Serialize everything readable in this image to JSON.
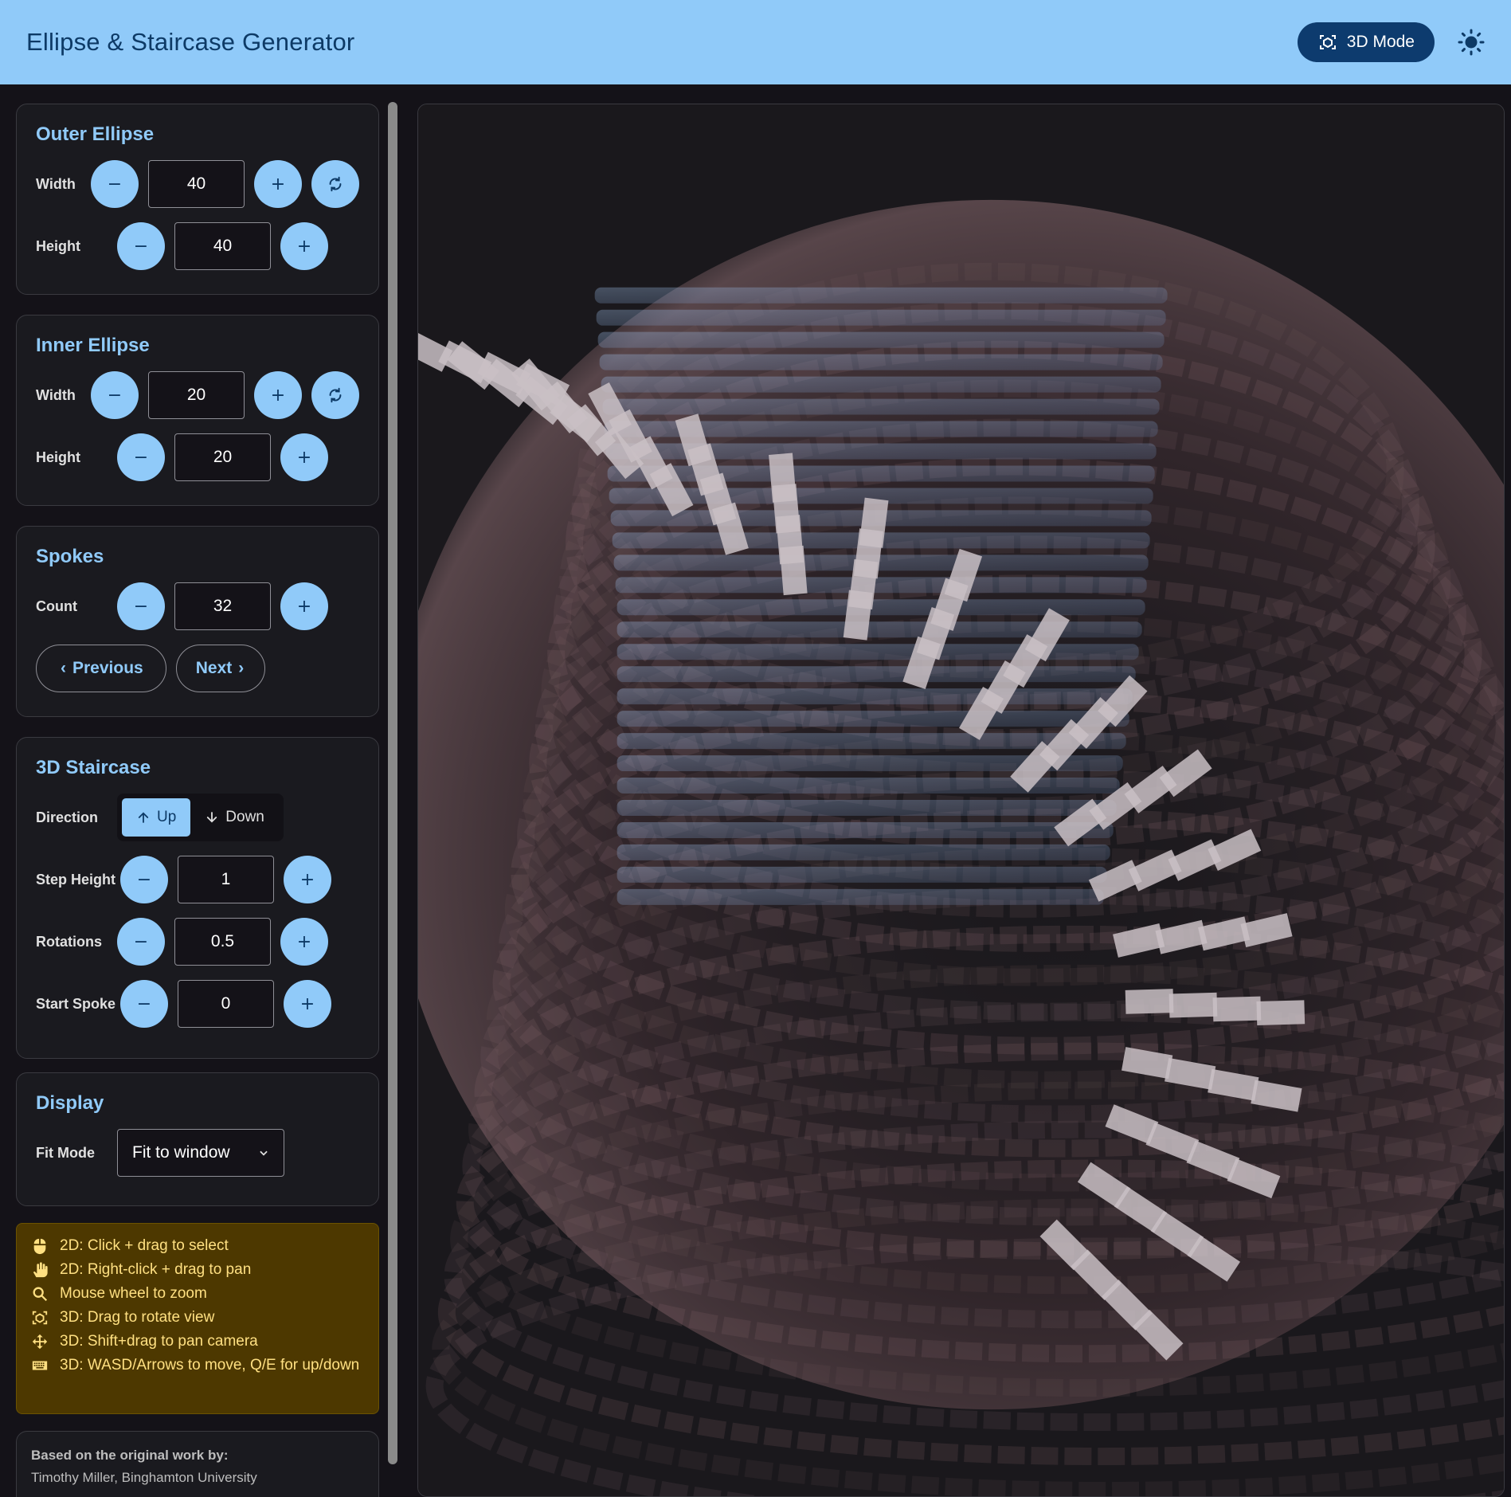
{
  "header": {
    "title": "Ellipse & Staircase Generator",
    "mode_button": "3D Mode"
  },
  "outer_ellipse": {
    "title": "Outer Ellipse",
    "width_label": "Width",
    "width_value": "40",
    "height_label": "Height",
    "height_value": "40"
  },
  "inner_ellipse": {
    "title": "Inner Ellipse",
    "width_label": "Width",
    "width_value": "20",
    "height_label": "Height",
    "height_value": "20"
  },
  "spokes": {
    "title": "Spokes",
    "count_label": "Count",
    "count_value": "32",
    "previous_label": "Previous",
    "next_label": "Next"
  },
  "staircase": {
    "title": "3D Staircase",
    "direction_label": "Direction",
    "direction_options": [
      "Up",
      "Down"
    ],
    "direction_selected": "Up",
    "step_height_label": "Step Height",
    "step_height_value": "1",
    "rotations_label": "Rotations",
    "rotations_value": "0.5",
    "start_spoke_label": "Start Spoke",
    "start_spoke_value": "0"
  },
  "display": {
    "title": "Display",
    "fit_mode_label": "Fit Mode",
    "fit_mode_value": "Fit to window"
  },
  "help": [
    {
      "icon": "mouse-icon",
      "text": "2D: Click + drag to select"
    },
    {
      "icon": "hand-icon",
      "text": "2D: Right-click + drag to pan"
    },
    {
      "icon": "zoom-icon",
      "text": "Mouse wheel to zoom"
    },
    {
      "icon": "3d-rotation-icon",
      "text": "3D: Drag to rotate view"
    },
    {
      "icon": "move-icon",
      "text": "3D: Shift+drag to pan camera"
    },
    {
      "icon": "keyboard-icon",
      "text": "3D: WASD/Arrows to move, Q/E for up/down"
    }
  ],
  "credits": {
    "title": "Based on the original work by:",
    "text": "Timothy Miller, Binghamton University"
  },
  "colors": {
    "header_bg": "#90caf9",
    "accent": "#90caf9",
    "mode_button_bg": "#0d3b6e",
    "help_bg": "#4d3800",
    "help_text": "#ffe082",
    "step_color": "#c9bfc4",
    "inner_color": "#8fb0dc",
    "outer_color": "#8a6a6f"
  }
}
